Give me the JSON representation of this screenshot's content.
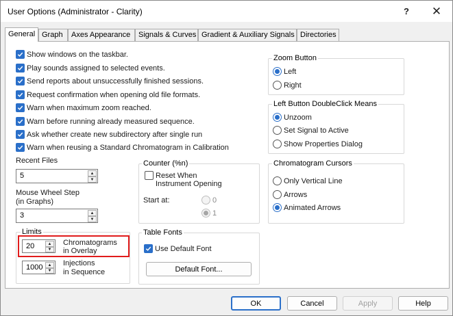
{
  "window": {
    "title": "User Options (Administrator - Clarity)",
    "help_glyph": "?",
    "close_glyph": "✕"
  },
  "tabs": [
    {
      "label": "General",
      "active": true
    },
    {
      "label": "Graph"
    },
    {
      "label": "Axes Appearance"
    },
    {
      "label": "Signals & Curves"
    },
    {
      "label": "Gradient & Auxiliary Signals"
    },
    {
      "label": "Directories"
    }
  ],
  "general_checks": [
    {
      "label": "Show windows on the taskbar.",
      "checked": true
    },
    {
      "label": "Play sounds assigned to selected events.",
      "checked": true
    },
    {
      "label": "Send reports about unsuccessfully finished sessions.",
      "checked": true
    },
    {
      "label": "Request confirmation when opening old file formats.",
      "checked": true
    },
    {
      "label": "Warn when maximum zoom reached.",
      "checked": true
    },
    {
      "label": "Warn before running already measured sequence.",
      "checked": true
    },
    {
      "label": "Ask whether create new subdirectory after single run",
      "checked": true
    },
    {
      "label": "Warn when reusing a Standard Chromatogram in Calibration",
      "checked": true
    }
  ],
  "recent_files": {
    "label": "Recent Files",
    "value": "5"
  },
  "mouse_wheel": {
    "label_line1": "Mouse Wheel Step",
    "label_line2": "(in Graphs)",
    "value": "3"
  },
  "limits": {
    "label": "Limits",
    "chromatograms": {
      "value": "20",
      "label_line1": "Chromatograms",
      "label_line2": "in Overlay"
    },
    "injections": {
      "value": "1000",
      "label_line1": "Injections",
      "label_line2": "in Sequence"
    }
  },
  "counter": {
    "label": "Counter (%n)",
    "reset_line1": "Reset When",
    "reset_line2": "Instrument Opening",
    "start_at": "Start at:",
    "options": [
      "0",
      "1"
    ]
  },
  "table_fonts": {
    "label": "Table Fonts",
    "use_default": "Use Default Font",
    "default_font_button": "Default Font..."
  },
  "zoom_button": {
    "label": "Zoom Button",
    "options": [
      {
        "label": "Left",
        "selected": true
      },
      {
        "label": "Right",
        "selected": false
      }
    ]
  },
  "left_dblclick": {
    "label": "Left Button DoubleClick Means",
    "options": [
      {
        "label": "Unzoom",
        "selected": true
      },
      {
        "label": "Set Signal to Active",
        "selected": false
      },
      {
        "label": "Show Properties Dialog",
        "selected": false
      }
    ]
  },
  "cursors": {
    "label": "Chromatogram Cursors",
    "options": [
      {
        "label": "Only Vertical Line",
        "selected": false
      },
      {
        "label": "Arrows",
        "selected": false
      },
      {
        "label": "Animated Arrows",
        "selected": true
      }
    ]
  },
  "buttons": {
    "ok": "OK",
    "cancel": "Cancel",
    "apply": "Apply",
    "help": "Help"
  },
  "colors": {
    "accent": "#2a6fc9",
    "highlight": "#e11b1b"
  }
}
